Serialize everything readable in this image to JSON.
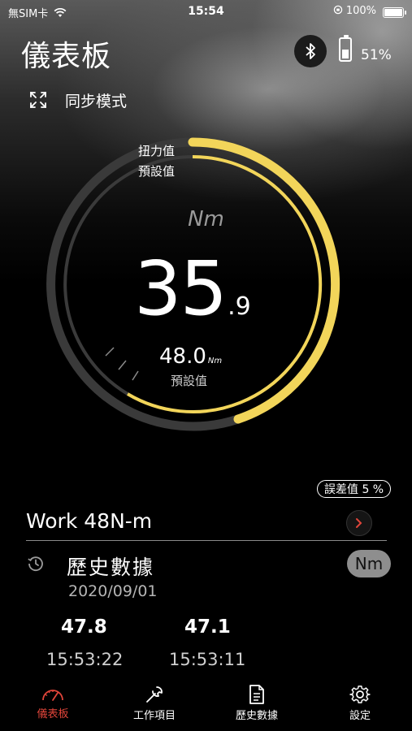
{
  "status_bar": {
    "carrier": "無SIM卡",
    "time": "15:54",
    "battery": "100%"
  },
  "header": {
    "title": "儀表板",
    "device_battery": "51%",
    "device_battery_level": 0.51
  },
  "sync": {
    "label": "同步模式"
  },
  "gauge": {
    "torque_label": "扭力值",
    "preset_label": "預設值",
    "unit": "Nm",
    "reading_int": "35",
    "reading_dec": ".9",
    "preset_value": "48.0",
    "preset_unit": "Nm",
    "preset_caption": "預設值",
    "accent_color": "#f2d55a"
  },
  "tolerance": {
    "label": "誤差值 5 %"
  },
  "work": {
    "name": "Work 48N-m"
  },
  "history": {
    "title": "歷史數據",
    "unit": "Nm",
    "date": "2020/09/01",
    "records": [
      {
        "value": "47.8",
        "time": "15:53:22"
      },
      {
        "value": "47.1",
        "time": "15:53:11"
      }
    ]
  },
  "tabs": [
    {
      "label": "儀表板",
      "icon": "gauge-icon",
      "active": true
    },
    {
      "label": "工作項目",
      "icon": "wrench-icon",
      "active": false
    },
    {
      "label": "歷史數據",
      "icon": "document-icon",
      "active": false
    },
    {
      "label": "設定",
      "icon": "gear-icon",
      "active": false
    }
  ],
  "colors": {
    "active_tab": "#e0453a",
    "accent": "#f2d55a"
  }
}
